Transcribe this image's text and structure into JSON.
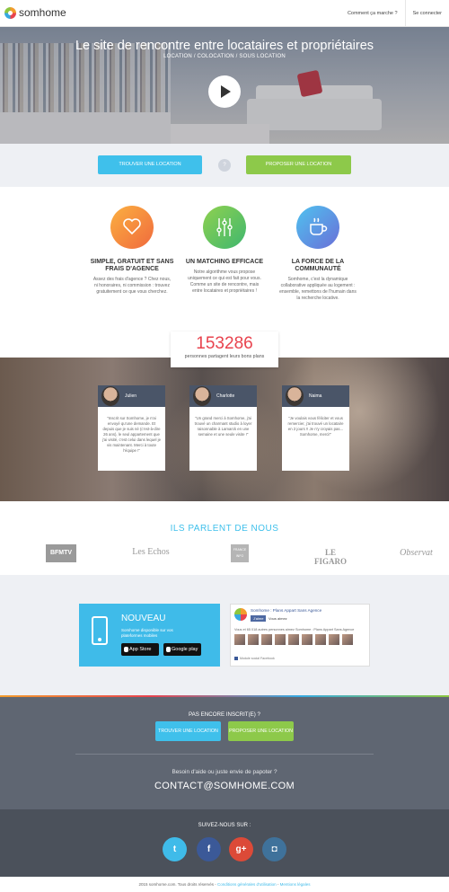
{
  "header": {
    "logo_text": "somhome",
    "nav": [
      "Comment ça marche ?",
      "Se connecter"
    ]
  },
  "hero": {
    "title": "Le site de rencontre entre locataires et propriétaires",
    "subtitle": "LOCATION / COLOCATION / SOUS LOCATION"
  },
  "search": {
    "find_label": "TROUVER UNE LOCATION",
    "or_label": "?",
    "offer_label": "PROPOSER UNE LOCATION"
  },
  "features": [
    {
      "title": "SIMPLE, GRATUIT ET SANS FRAIS D'AGENCE",
      "text": "Assez des frais d'agence ? Chez nous, ni honoraires, ni commission : trouvez gratuitement ce que vous cherchez.",
      "icon": "heart-icon",
      "colors": [
        "#fbb040",
        "#f06a3e"
      ]
    },
    {
      "title": "UN MATCHING EFFICACE",
      "text": "Notre algorithme vous propose uniquement ce qui est fait pour vous. Comme un site de rencontre, mais entre locataires et propriétaires !",
      "icon": "sliders-icon",
      "colors": [
        "#8fd14f",
        "#3fb76f"
      ]
    },
    {
      "title": "LA FORCE DE LA COMMUNAUTÉ",
      "text": "Somhome, c'est la dynamique collaborative appliquée au logement : ensemble, remettons de l'humain dans la recherche locative.",
      "icon": "coffee-icon",
      "colors": [
        "#4fc2ef",
        "#6a6fd8"
      ]
    }
  ],
  "counter": {
    "number": "153286",
    "label": "personnes partagent leurs bons plans"
  },
  "testimonials": [
    {
      "name": "Julien",
      "text": "\"Inscrit sur Somhome, je n'ai envoyé qu'une demande. Et depuis que je suis né (c'est-à-dire 26 ans), le seul appartement que j'ai visité, c'est celui dans lequel je vis maintenant. Merci à toute l'équipe !\""
    },
    {
      "name": "Charlotte",
      "text": "\"Un grand merci à Somhome, j'ai trouvé un charmant studio à loyer raisonnable à Lamarck en une semaine et une seule visite !\""
    },
    {
      "name": "Naima",
      "text": "\"Je voulais vous féliciter et vous remercier, j'ai trouvé un locataire en 2 jours !! Je n'y croyais pas... Somhome, merci!\""
    }
  ],
  "press": {
    "title": "ILS PARLENT DE NOUS",
    "logos": [
      "BFMTV",
      "Les Echos",
      "FRANCE INFO",
      "LE FIGARO",
      "Observat"
    ]
  },
  "app": {
    "title": "NOUVEAU",
    "subtitle": "Somhome disponible sur vos plateformes mobiles",
    "appstore": "App Store",
    "googleplay": "Google play"
  },
  "facebook": {
    "page_name": "Somhome : Plans Appart Sans Agence",
    "like_label": "J'aime",
    "count": "Vous aimez",
    "line": "Vous et 65 018 autres personnes aimez Somhome : Plans Appart Sans Agence",
    "footer": "Module social Facebook"
  },
  "footer": {
    "title": "PAS ENCORE INSCRIT(E) ?",
    "find_label": "TROUVER UNE LOCATION",
    "offer_label": "PROPOSER UNE LOCATION",
    "help": "Besoin d'aide ou juste envie de papoter ?",
    "contact": "CONTACT@SOMHOME.COM"
  },
  "social": {
    "title": "SUIVEZ-NOUS SUR :",
    "twitter": "t",
    "facebook": "f",
    "googleplus": "g+",
    "instagram": "◘"
  },
  "copyright": {
    "text": "2015 somhome.com. Tous droits réservés -",
    "cgu": "Conditions générales d'utilisation",
    "sep": " - ",
    "legal": "Mentions légales"
  }
}
